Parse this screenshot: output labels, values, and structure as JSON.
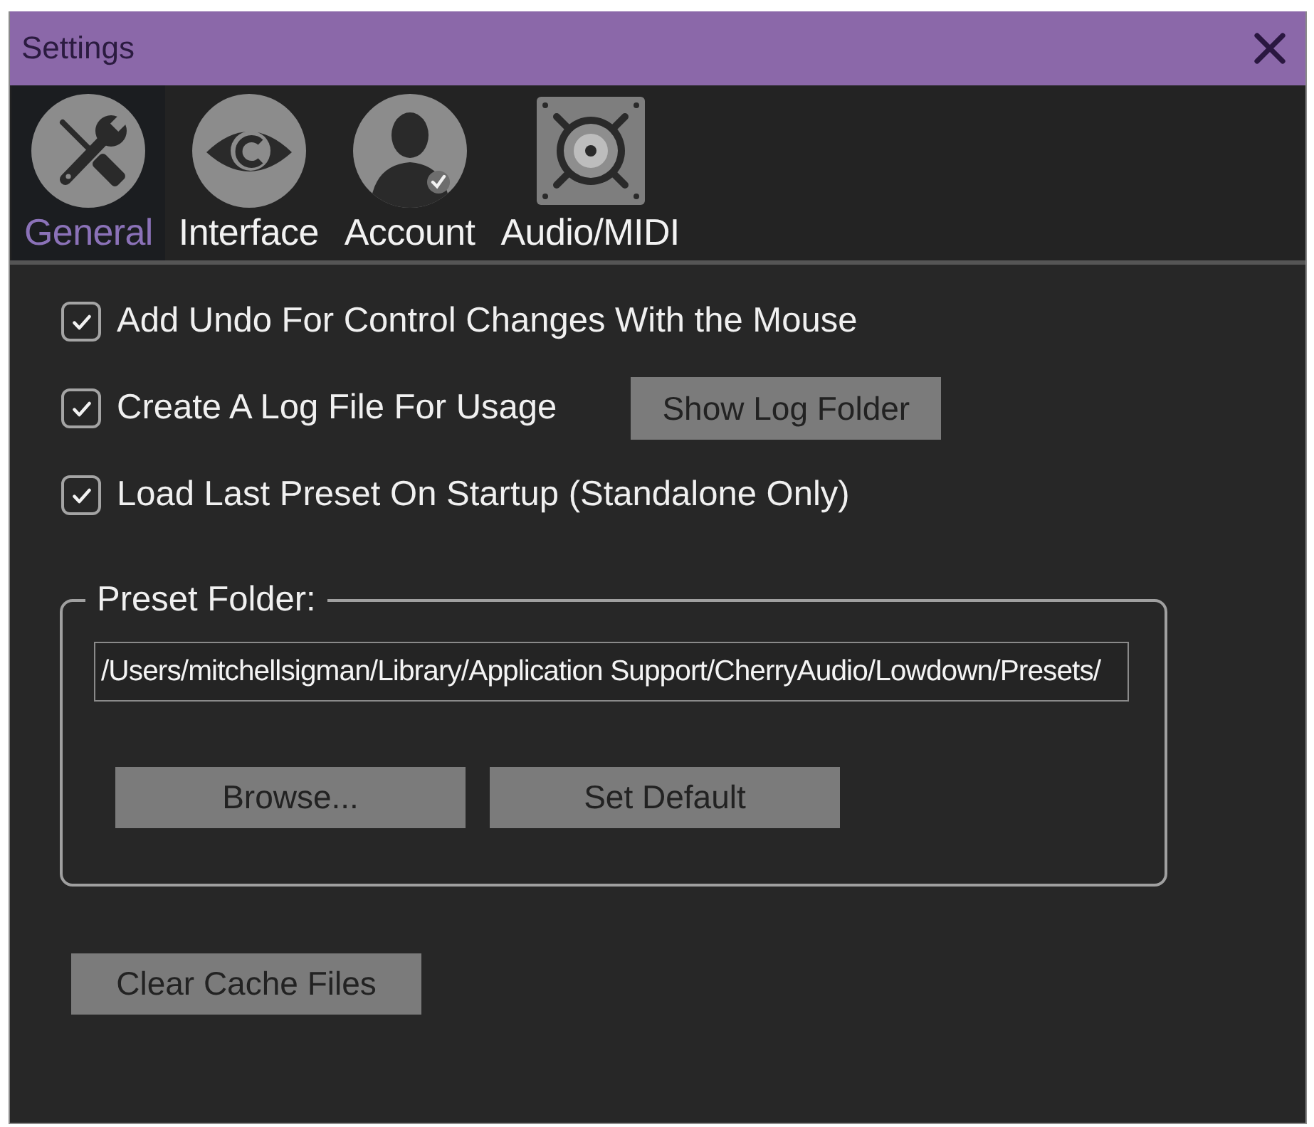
{
  "window": {
    "title": "Settings"
  },
  "tabs": [
    {
      "label": "General",
      "selected": true
    },
    {
      "label": "Interface",
      "selected": false
    },
    {
      "label": "Account",
      "selected": false
    },
    {
      "label": "Audio/MIDI",
      "selected": false
    }
  ],
  "options": [
    {
      "label": "Add Undo For Control Changes With the Mouse",
      "checked": true
    },
    {
      "label": "Create A Log File For Usage",
      "checked": true,
      "button": "Show Log Folder"
    },
    {
      "label": "Load Last Preset On Startup (Standalone Only)",
      "checked": true
    }
  ],
  "preset_folder": {
    "legend": "Preset Folder:",
    "path": "/Users/mitchellsigman/Library/Application Support/CherryAudio/Lowdown/Presets/",
    "buttons": [
      "Browse...",
      "Set Default"
    ]
  },
  "clear_cache_button": "Clear Cache Files"
}
